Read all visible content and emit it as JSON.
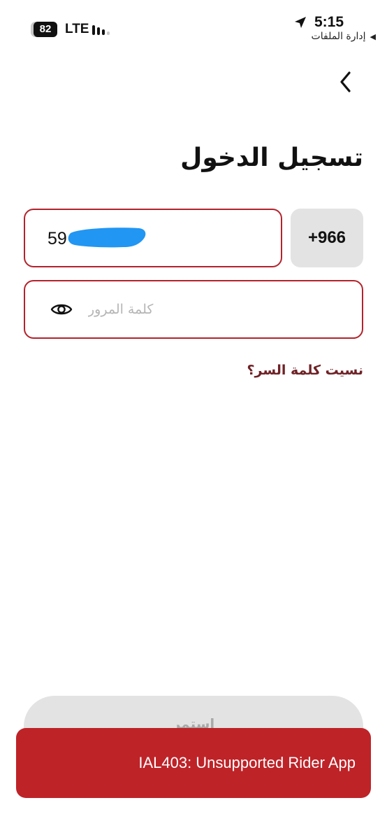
{
  "status_bar": {
    "battery_level": "82",
    "network": "LTE",
    "time": "5:15",
    "back_to_app": "إدارة الملفات",
    "icons": [
      "battery-icon",
      "signal-icon",
      "location-arrow-icon",
      "back-triangle-icon"
    ]
  },
  "nav": {
    "back_icon": "chevron-left-icon"
  },
  "page": {
    "title": "تسجيل الدخول"
  },
  "phone": {
    "country_code": "+966",
    "value_visible": "59",
    "value_redacted": true
  },
  "password": {
    "placeholder": "كلمة المرور",
    "toggle_icon": "eye-icon"
  },
  "forgot_password": "نسيت كلمة السر؟",
  "continue_button": {
    "label": "استمر"
  },
  "toast": {
    "message": "IAL403: Unsupported Rider App"
  },
  "colors": {
    "field_border": "#b3232c",
    "toast_background": "#be2328",
    "link": "#6e2226",
    "redaction": "#2196f3",
    "country_code_background": "#e3e3e3"
  }
}
